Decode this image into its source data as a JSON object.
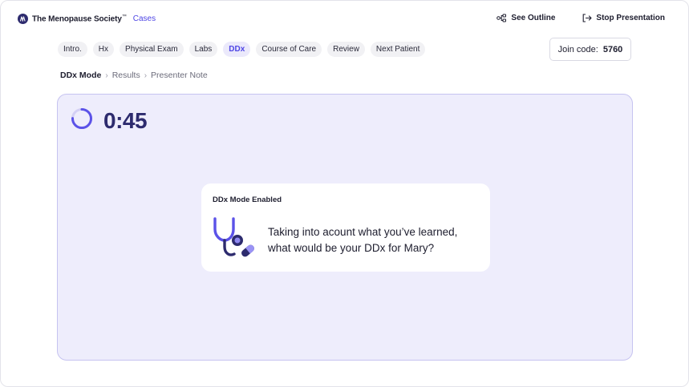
{
  "header": {
    "brand_name": "The Menopause Society",
    "brand_tm": "™",
    "brand_product": "Cases",
    "see_outline_label": "See Outline",
    "stop_presentation_label": "Stop Presentation"
  },
  "tabs": [
    {
      "label": "Intro.",
      "active": false
    },
    {
      "label": "Hx",
      "active": false
    },
    {
      "label": "Physical Exam",
      "active": false
    },
    {
      "label": "Labs",
      "active": false
    },
    {
      "label": "DDx",
      "active": true
    },
    {
      "label": "Course of Care",
      "active": false
    },
    {
      "label": "Review",
      "active": false
    },
    {
      "label": "Next Patient",
      "active": false
    }
  ],
  "join": {
    "label": "Join code:",
    "code": "5760"
  },
  "breadcrumb": {
    "items": [
      "DDx Mode",
      "Results",
      "Presenter Note"
    ],
    "separator": "›"
  },
  "timer": {
    "display": "0:45",
    "progress_fraction": 0.75
  },
  "card": {
    "title": "DDx Mode Enabled",
    "question": "Taking into acount what you’ve learned, what would be your DDx for Mary?",
    "icon": "stethoscope-pill-icon"
  },
  "colors": {
    "accent": "#4f46e5",
    "brand_dark": "#2d2b6e",
    "panel_bg": "#eeedfc",
    "panel_border": "#c6c3f0"
  }
}
